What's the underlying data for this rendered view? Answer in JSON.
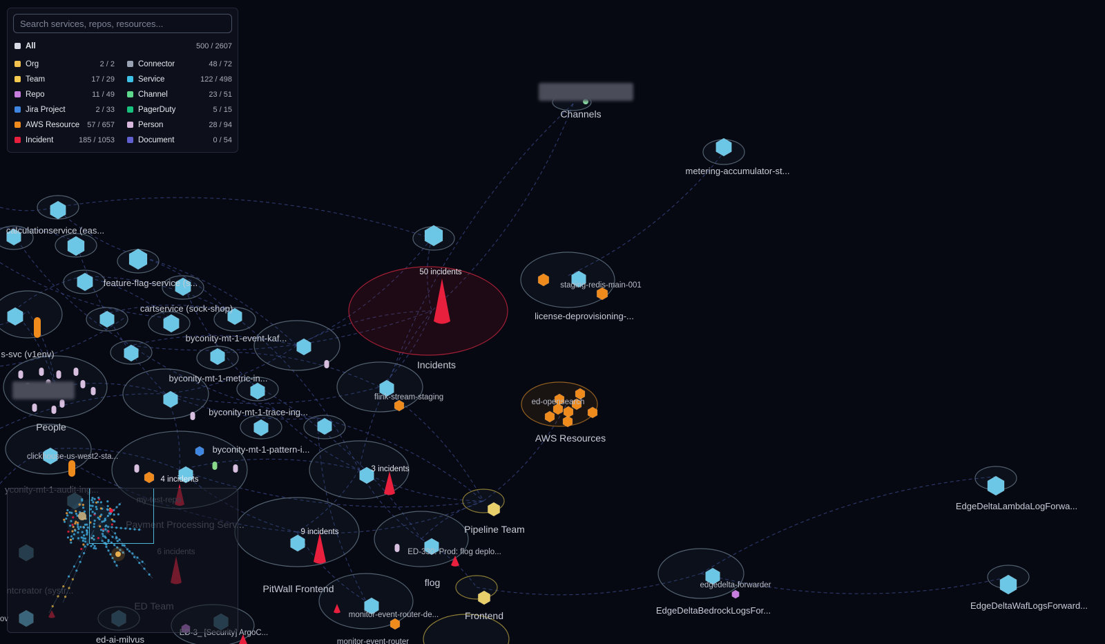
{
  "filter_panel": {
    "search_placeholder": "Search services, repos, resources...",
    "all": {
      "label": "All",
      "count": "500 / 2607",
      "color": "#d9dbe4"
    },
    "left_column": [
      {
        "label": "Org",
        "count": "2 / 2",
        "color": "#f2c14e"
      },
      {
        "label": "Team",
        "count": "17 / 29",
        "color": "#f4c94f"
      },
      {
        "label": "Repo",
        "count": "11 / 49",
        "color": "#c77dde"
      },
      {
        "label": "Jira Project",
        "count": "2 / 33",
        "color": "#3f86e0"
      },
      {
        "label": "AWS Resource",
        "count": "57 / 657",
        "color": "#ef8a1c"
      },
      {
        "label": "Incident",
        "count": "185 / 1053",
        "color": "#e8203d"
      }
    ],
    "right_column": [
      {
        "label": "Connector",
        "count": "48 / 72",
        "color": "#9aa3b3"
      },
      {
        "label": "Service",
        "count": "122 / 498",
        "color": "#3ec1e6"
      },
      {
        "label": "Channel",
        "count": "23 / 51",
        "color": "#5ed88a"
      },
      {
        "label": "PagerDuty",
        "count": "5 / 15",
        "color": "#17c27e"
      },
      {
        "label": "Person",
        "count": "28 / 94",
        "color": "#d8b8dc"
      },
      {
        "label": "Document",
        "count": "0 / 54",
        "color": "#6060d0"
      }
    ]
  },
  "graph": {
    "cluster_labels": [
      "Channels",
      "Incidents",
      "AWS Resources",
      "People",
      "Pipeline Team",
      "PitWall Frontend",
      "flog",
      "Frontend",
      "ED Team",
      "Payment Processing Serv..."
    ],
    "incident_labels": [
      "50 incidents",
      "3 incidents",
      "4 incidents",
      "9 incidents",
      "6 incidents"
    ],
    "service_labels": [
      "metering-accumulator-st...",
      "calculationservice (eas...",
      "feature-flag-service (s...",
      "cartservice (sock-shop)",
      "byconity-mt-1-event-kaf...",
      "s-svc (v1env)",
      "byconity-mt-1-metric-in...",
      "byconity-mt-1-trace-ing...",
      "byconity-mt-1-pattern-i...",
      "clickhouse-us-west2-sta...",
      "yconity-mt-1-audit-ing...",
      "staging-redis-main-001",
      "license-deprovisioning-...",
      "flink-stream-staging",
      "ed-opensearch",
      "EdgeDeltaLambdaLogForwa...",
      "edgedelta-forwarder",
      "EdgeDeltaBedrockLogsFor...",
      "EdgeDeltaWafLogsForward...",
      "ED-330: Prod: flog deplo...",
      "monitor-event-router-de...",
      "monitor-event-router",
      "ed-ai-milvus",
      "ED-3_ [Security] ArgoC...",
      "my-test-repo",
      "ntcreator (systr...",
      "ov"
    ]
  },
  "colors": {
    "background": "#070912",
    "service": "#6cc6e6",
    "incident": "#e8203d",
    "aws": "#ef8a1c",
    "team": "#e8cf6a",
    "person": "#d8bfe0",
    "edge": "#3c4a8c"
  }
}
